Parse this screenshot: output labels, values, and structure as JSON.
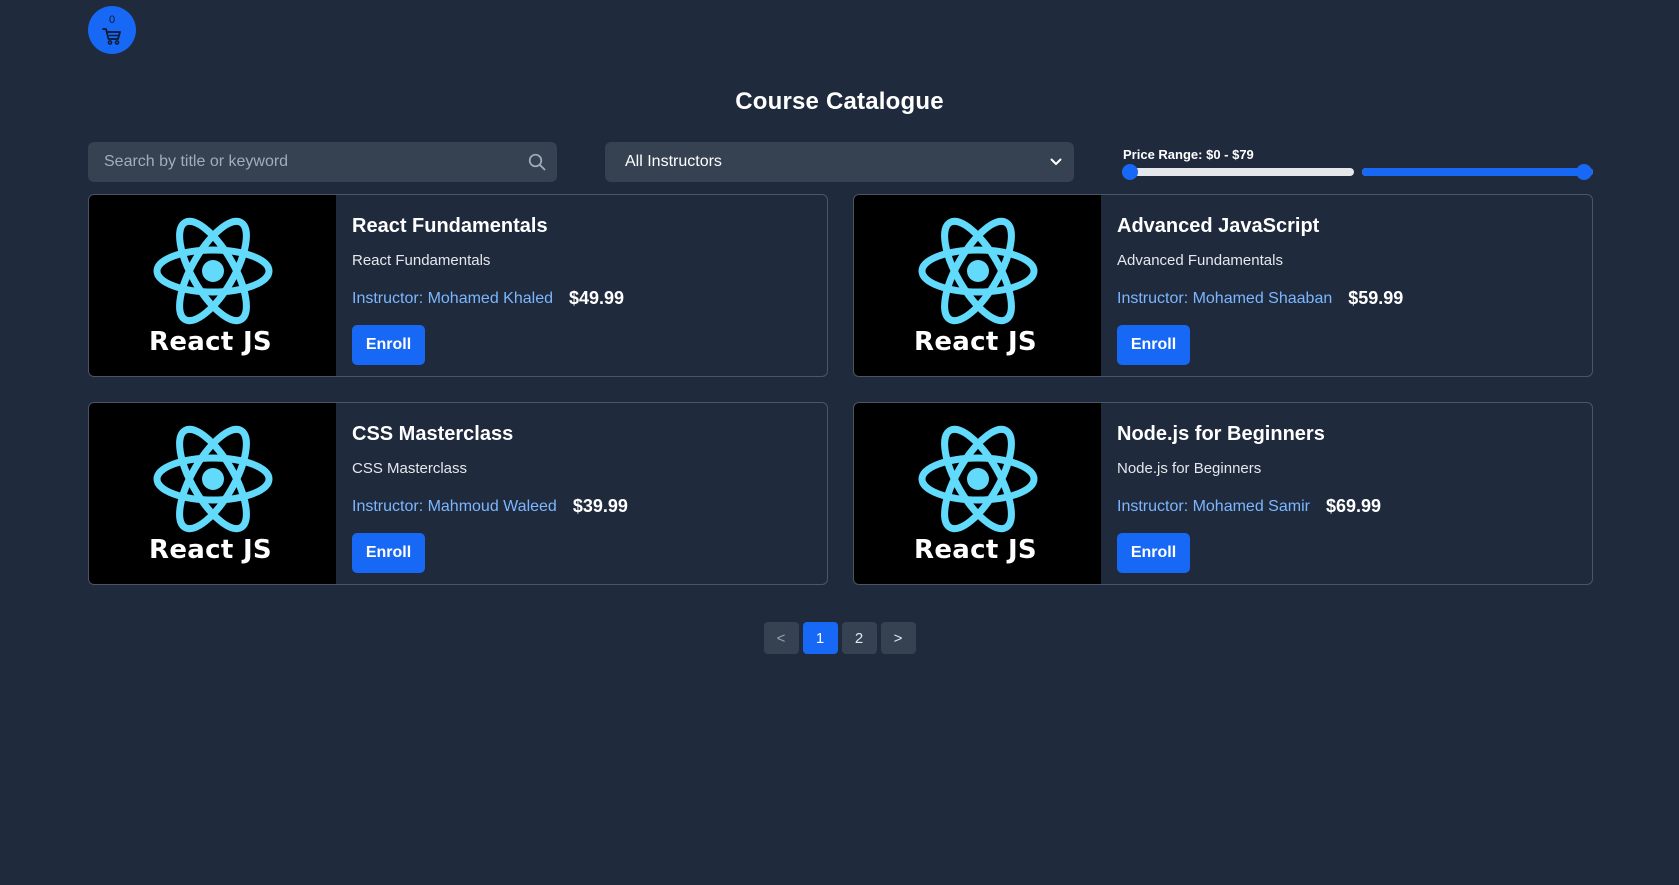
{
  "cart": {
    "count": "0"
  },
  "page_title": "Course Catalogue",
  "search": {
    "placeholder": "Search by title or keyword",
    "value": ""
  },
  "instructor_filter": {
    "selected": "All Instructors"
  },
  "price_range": {
    "label": "Price Range: $0 - $79",
    "min": 0,
    "max": 79
  },
  "courses": [
    {
      "title": "React Fundamentals",
      "description": "React Fundamentals",
      "instructor": "Instructor: Mohamed Khaled",
      "price": "$49.99",
      "thumbnail_text": "React JS",
      "enroll_label": "Enroll"
    },
    {
      "title": "Advanced JavaScript",
      "description": "Advanced Fundamentals",
      "instructor": "Instructor: Mohamed Shaaban",
      "price": "$59.99",
      "thumbnail_text": "React JS",
      "enroll_label": "Enroll"
    },
    {
      "title": "CSS Masterclass",
      "description": "CSS Masterclass",
      "instructor": "Instructor: Mahmoud Waleed",
      "price": "$39.99",
      "thumbnail_text": "React JS",
      "enroll_label": "Enroll"
    },
    {
      "title": "Node.js for Beginners",
      "description": "Node.js for Beginners",
      "instructor": "Instructor: Mohamed Samir",
      "price": "$69.99",
      "thumbnail_text": "React JS",
      "enroll_label": "Enroll"
    }
  ],
  "pagination": {
    "prev": "<",
    "pages": [
      "1",
      "2"
    ],
    "current": "1",
    "next": ">"
  },
  "colors": {
    "background": "#1f2a3d",
    "accent": "#1768f5",
    "instructor_text": "#7cb6ff",
    "react_logo": "#61dafb"
  }
}
